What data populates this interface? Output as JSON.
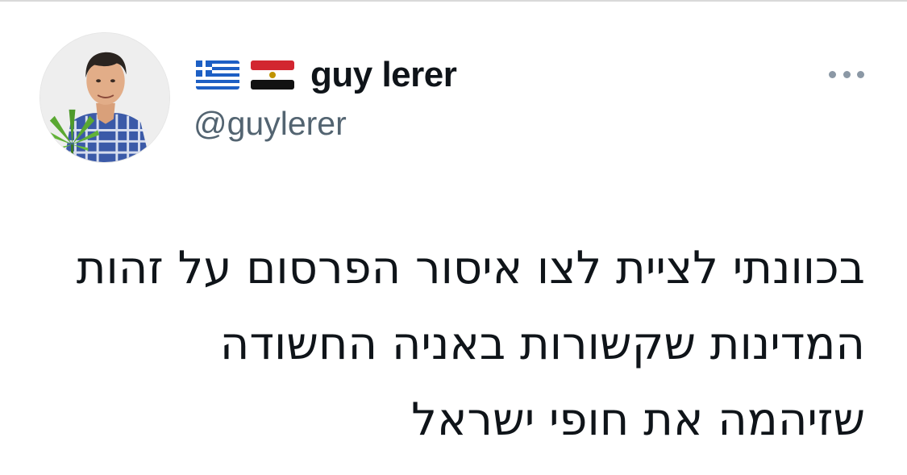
{
  "author": {
    "display_name": "guy lerer",
    "handle": "@guylerer",
    "name_flags": [
      "greece-flag",
      "egypt-flag"
    ],
    "avatar": "profile-photo-with-cannabis-leaf"
  },
  "menu": {
    "icon": "more-horizontal-icon"
  },
  "tweet": {
    "lines": [
      "בכוונתי לציית לצו איסור הפרסום על זהות",
      "המדינות שקשורות באניה החשודה",
      "שזיהמה את חופי ישראל"
    ]
  },
  "colors": {
    "text": "#0f1419",
    "handle": "#536471",
    "more_dots": "#8b98a5",
    "background": "#ffffff"
  }
}
